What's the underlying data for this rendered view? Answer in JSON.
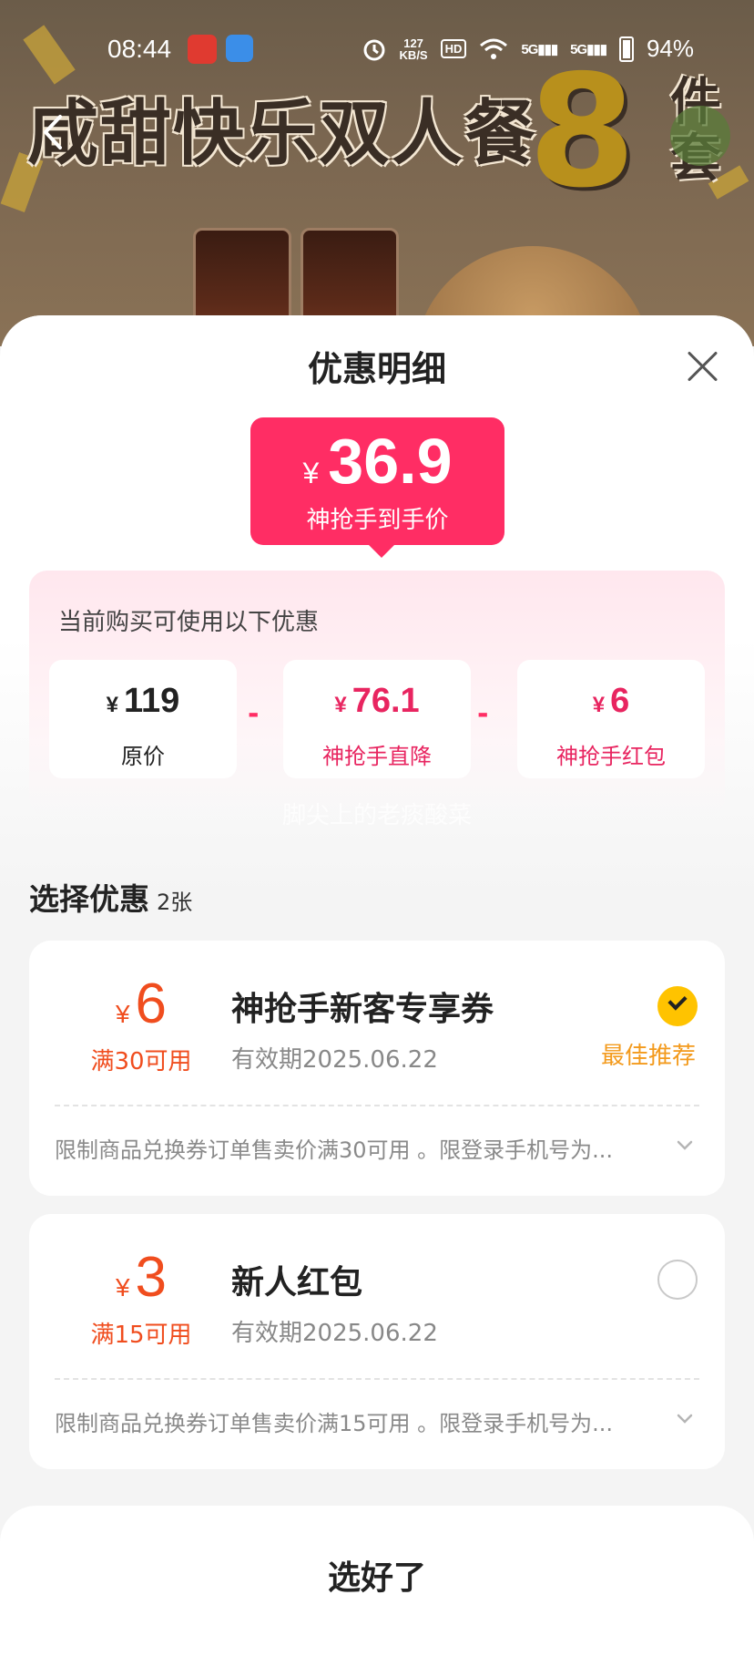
{
  "status_bar": {
    "time": "08:44",
    "net_speed_value": "127",
    "net_speed_unit": "KB/S",
    "hd_badge": "HD",
    "signal1": "5G",
    "signal2": "5G",
    "battery": "94%"
  },
  "banner": {
    "title": "咸甜快乐双人餐",
    "number": "8",
    "suffix_line1": "件",
    "suffix_line2": "套"
  },
  "sheet": {
    "title": "优惠明细",
    "final_price": {
      "currency": "¥",
      "amount": "36.9",
      "label": "神抢手到手价"
    },
    "breakdown": {
      "caption": "当前购买可使用以下优惠",
      "items": [
        {
          "currency": "¥",
          "amount": "119",
          "label": "原价"
        },
        {
          "currency": "¥",
          "amount": "76.1",
          "label": "神抢手直降"
        },
        {
          "currency": "¥",
          "amount": "6",
          "label": "神抢手红包"
        }
      ],
      "operator": "-"
    },
    "watermark": "脚尖上的老痰酸菜",
    "choose": {
      "title": "选择优惠",
      "count": "2张"
    },
    "coupons": [
      {
        "currency": "¥",
        "amount": "6",
        "condition": "满30可用",
        "name": "神抢手新客专享券",
        "expiry": "有效期2025.06.22",
        "badge": "最佳推荐",
        "selected": true,
        "rule": "限制商品兑换券订单售卖价满30可用 。限登录手机号为..."
      },
      {
        "currency": "¥",
        "amount": "3",
        "condition": "满15可用",
        "name": "新人红包",
        "expiry": "有效期2025.06.22",
        "badge": "",
        "selected": false,
        "rule": "限制商品兑换券订单售卖价满15可用 。限登录手机号为..."
      }
    ],
    "confirm_label": "选好了"
  },
  "colors": {
    "accent_pink": "#ff2d64",
    "coupon_orange": "#f04d1e",
    "recommend_orange": "#f39a1c",
    "check_yellow": "#ffc300"
  }
}
